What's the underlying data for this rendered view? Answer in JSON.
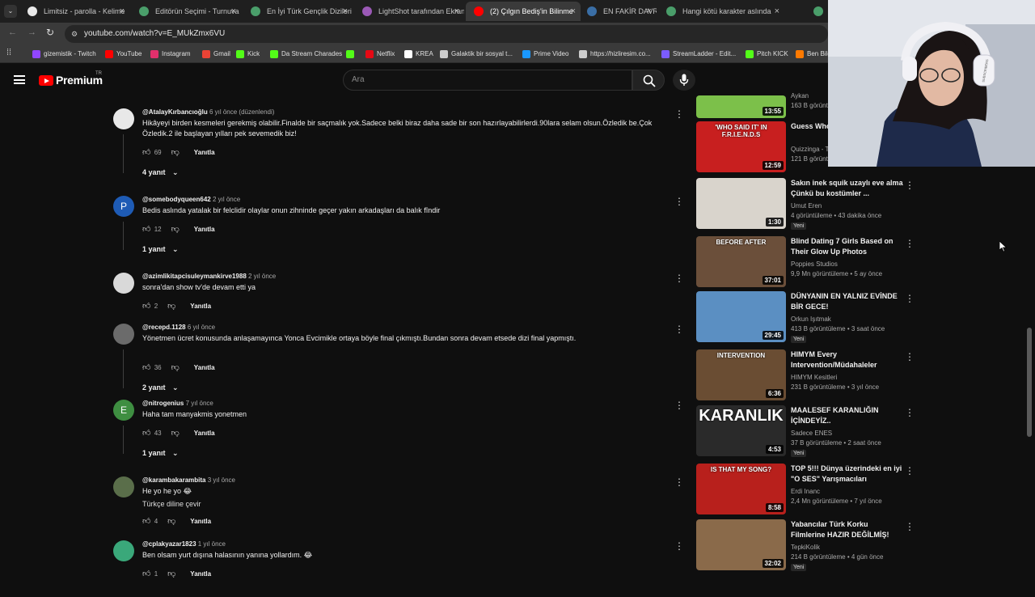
{
  "browser": {
    "tabs": [
      {
        "label": "Limitsiz - parolla - Kelime",
        "color": "#e9e9e9"
      },
      {
        "label": "Editörün Seçimi - Turnuva",
        "color": "#4a9e6a"
      },
      {
        "label": "En İyi Türk Gençlik Dizileri",
        "color": "#4a9e6a"
      },
      {
        "label": "LightShot tarafından Ekran",
        "color": "#9b59b6"
      },
      {
        "label": "(2) Çılgın Bediş'in Bilinme",
        "color": "#ff0000"
      },
      {
        "label": "EN FAKİR DAVRANIŞ",
        "color": "#3a6ea5"
      },
      {
        "label": "Hangi kötü karakter aslında",
        "color": "#4a9e6a"
      },
      {
        "label": "En",
        "color": "#4a9e6a"
      }
    ],
    "url": "youtube.com/watch?v=E_MUkZmx6VU",
    "bookmarks": [
      {
        "label": "gizemistik - Twitch",
        "color": "#9146ff"
      },
      {
        "label": "YouTube",
        "color": "#ff0000"
      },
      {
        "label": "Instagram",
        "color": "#e1306c"
      },
      {
        "label": "Gmail",
        "color": "#ea4335"
      },
      {
        "label": "Kick",
        "color": "#53fc18"
      },
      {
        "label": "Da Stream Charades",
        "color": "#53fc18"
      },
      {
        "label": "",
        "color": "#53fc18"
      },
      {
        "label": "Netflix",
        "color": "#e50914"
      },
      {
        "label": "KREA",
        "color": "#ffffff"
      },
      {
        "label": "Galaktik bir sosyal t...",
        "color": "#cccccc"
      },
      {
        "label": "Prime Video",
        "color": "#1a98ff"
      },
      {
        "label": "https://hizliresim.co...",
        "color": "#cccccc"
      },
      {
        "label": "StreamLadder - Edit...",
        "color": "#7b5cff"
      },
      {
        "label": "Pitch KICK",
        "color": "#53fc18"
      },
      {
        "label": "Ben Bild",
        "color": "#ff7a00"
      }
    ]
  },
  "header": {
    "logo": "Premium",
    "region": "TR",
    "search_placeholder": "Ara"
  },
  "comments": [
    {
      "user": "@AtalayKırbancıoğlu",
      "meta": "6 yıl önce (düzenlendi)",
      "text": "Hikâyeyi birden kesmeleri gerekmiş olabilir.Finalde bir saçmalık yok.Sadece belki biraz daha sade bir son hazırlayabilirlerdi.90lara selam olsun.Özledik be.Çok Özledik.2 ile başlayan yılları pek sevemedik biz!",
      "likes": "69",
      "reply": "Yanıtla",
      "replies": "4 yanıt",
      "avatar_color": "#e8e8e8",
      "avatar_letter": ""
    },
    {
      "user": "@somebodyqueen642",
      "meta": "2 yıl önce",
      "text": "Bedis aslında yatalak bir felclidir olaylar onun zihninde geçer yakın arkadaşları da balık fîndir",
      "likes": "12",
      "reply": "Yanıtla",
      "replies": "1 yanıt",
      "avatar_color": "#1e5bb5",
      "avatar_letter": "P"
    },
    {
      "user": "@azimlikitapcisuleymankirve1988",
      "meta": "2 yıl önce",
      "text": "sonra'dan show tv'de devam etti ya",
      "likes": "2",
      "reply": "Yanıtla",
      "replies": "",
      "avatar_color": "#d9d9d9",
      "avatar_letter": ""
    },
    {
      "user": "@recepd.1128",
      "meta": "6 yıl önce",
      "text": "Yönetmen ücret konusunda anlaşamayınca Yonca Evcimikle ortaya böyle final çıkmıştı.Bundan sonra devam etsede dizi final yapmıştı.",
      "likes": "36",
      "reply": "Yanıtla",
      "replies": "2 yanıt",
      "avatar_color": "#6b6b6b",
      "avatar_letter": ""
    },
    {
      "user": "@nitrogenius",
      "meta": "7 yıl önce",
      "text": "Haha tam manyakmis yonetmen",
      "likes": "43",
      "reply": "Yanıtla",
      "replies": "1 yanıt",
      "avatar_color": "#3e8e41",
      "avatar_letter": "E"
    },
    {
      "user": "@karambakarambita",
      "meta": "3 yıl önce",
      "text": "He yo he yo 😂",
      "translate": "Türkçe diline çevir",
      "likes": "4",
      "reply": "Yanıtla",
      "replies": "",
      "avatar_color": "#5a6e4a",
      "avatar_letter": ""
    },
    {
      "user": "@cplakyazar1823",
      "meta": "1 yıl önce",
      "text": "Ben olsam yurt dışına halasının yanına yollardım. 😂",
      "likes": "1",
      "reply": "Yanıtla",
      "replies": "",
      "avatar_color": "#3aa87a",
      "avatar_letter": ""
    }
  ],
  "sidebar": [
    {
      "title": "",
      "channel": "Aykan",
      "meta": "163 B görüntü",
      "duration": "13:55",
      "badge": "",
      "thumb": "#7cc04a"
    },
    {
      "title": "Guess Who FRIENDS Ed",
      "channel": "Quizzinga - T",
      "meta": "121 B görüntü",
      "duration": "12:59",
      "badge": "",
      "thumb_text": "'WHO SAID IT' IN F.R.I.E.N.D.S",
      "thumb": "#c81f1f"
    },
    {
      "title": "Sakın inek squik uzaylı eve alma Çünkü bu kostümler ...",
      "channel": "Umut Eren",
      "meta": "4 görüntüleme • 43 dakika önce",
      "duration": "1:30",
      "badge": "Yeni",
      "thumb": "#d9d4cc"
    },
    {
      "title": "Blind Dating 7 Girls Based on Their Glow Up Photos",
      "channel": "Poppies Studios",
      "meta": "9,9 Mn görüntüleme • 5 ay önce",
      "duration": "37:01",
      "badge": "",
      "thumb_text": "BEFORE   AFTER",
      "thumb": "#6b4f3a"
    },
    {
      "title": "DÜNYANIN EN YALNIZ EVİNDE BİR GECE!",
      "channel": "Orkun Işıtmak",
      "meta": "413 B görüntüleme • 3 saat önce",
      "duration": "29:45",
      "badge": "Yeni",
      "thumb": "#5b8fc2"
    },
    {
      "title": "HIMYM Every Intervention/Müdahaleler",
      "channel": "HIMYM Kesitleri",
      "meta": "231 B görüntüleme • 3 yıl önce",
      "duration": "6:36",
      "badge": "",
      "thumb_text": "INTERVENTION",
      "thumb": "#6a4d33"
    },
    {
      "title": "MAALESEF KARANLIĞIN İÇİNDEYİZ..",
      "channel": "Sadece ENES",
      "meta": "37 B görüntüleme • 2 saat önce",
      "duration": "4:53",
      "badge": "Yeni",
      "thumb_text": "KARANLIK",
      "thumb": "#2a2a2a"
    },
    {
      "title": "TOP 5!!! Dünya üzerindeki en iyi \"O SES\" Yarışmacıları",
      "channel": "Erdi Inanc",
      "meta": "2,4 Mn görüntüleme • 7 yıl önce",
      "duration": "8:58",
      "badge": "",
      "thumb_text": "IS THAT MY SONG?",
      "thumb": "#b8201c"
    },
    {
      "title": "Yabancılar Türk Korku Filmlerine HAZIR DEĞİLMİŞ!",
      "channel": "TepkiKolik",
      "meta": "214 B görüntüleme • 4 gün önce",
      "duration": "32:02",
      "badge": "Yeni",
      "thumb": "#8a6a4a"
    }
  ],
  "webcam": {
    "headset_text": "SUBSCRIBERS"
  }
}
